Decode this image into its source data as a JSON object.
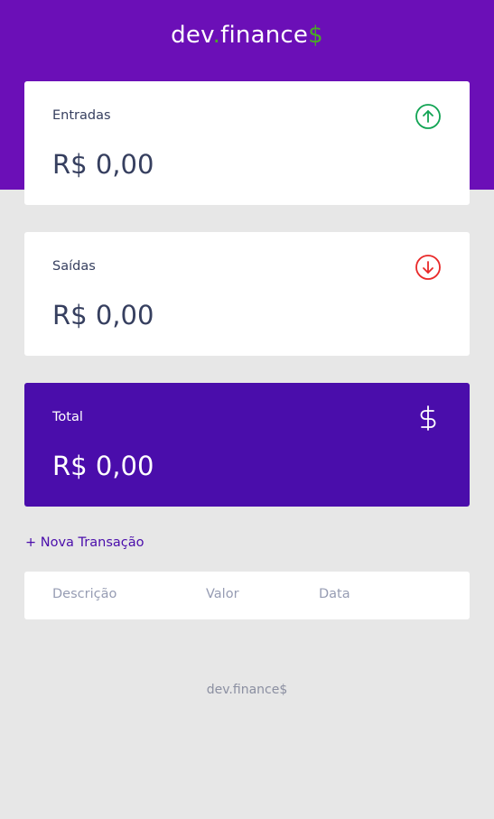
{
  "header": {
    "logo_prefix": "dev",
    "logo_dot": ".",
    "logo_main": "finance",
    "logo_suffix": "$"
  },
  "cards": {
    "income": {
      "label": "Entradas",
      "value": "R$ 0,00",
      "icon": "arrow-up-circle-icon"
    },
    "expense": {
      "label": "Saídas",
      "value": "R$ 0,00",
      "icon": "arrow-down-circle-icon"
    },
    "total": {
      "label": "Total",
      "value": "R$ 0,00",
      "icon": "dollar-icon"
    }
  },
  "actions": {
    "new_transaction": "+ Nova Transação"
  },
  "table": {
    "headers": [
      "Descrição",
      "Valor",
      "Data"
    ],
    "rows": []
  },
  "footer": {
    "text": "dev.finance$"
  },
  "colors": {
    "brand": "#6b0fb7",
    "total_card": "#4a0dab",
    "income": "#12a454",
    "expense": "#e92929",
    "accent_green": "#49aa26",
    "background": "#e7e7e7"
  }
}
